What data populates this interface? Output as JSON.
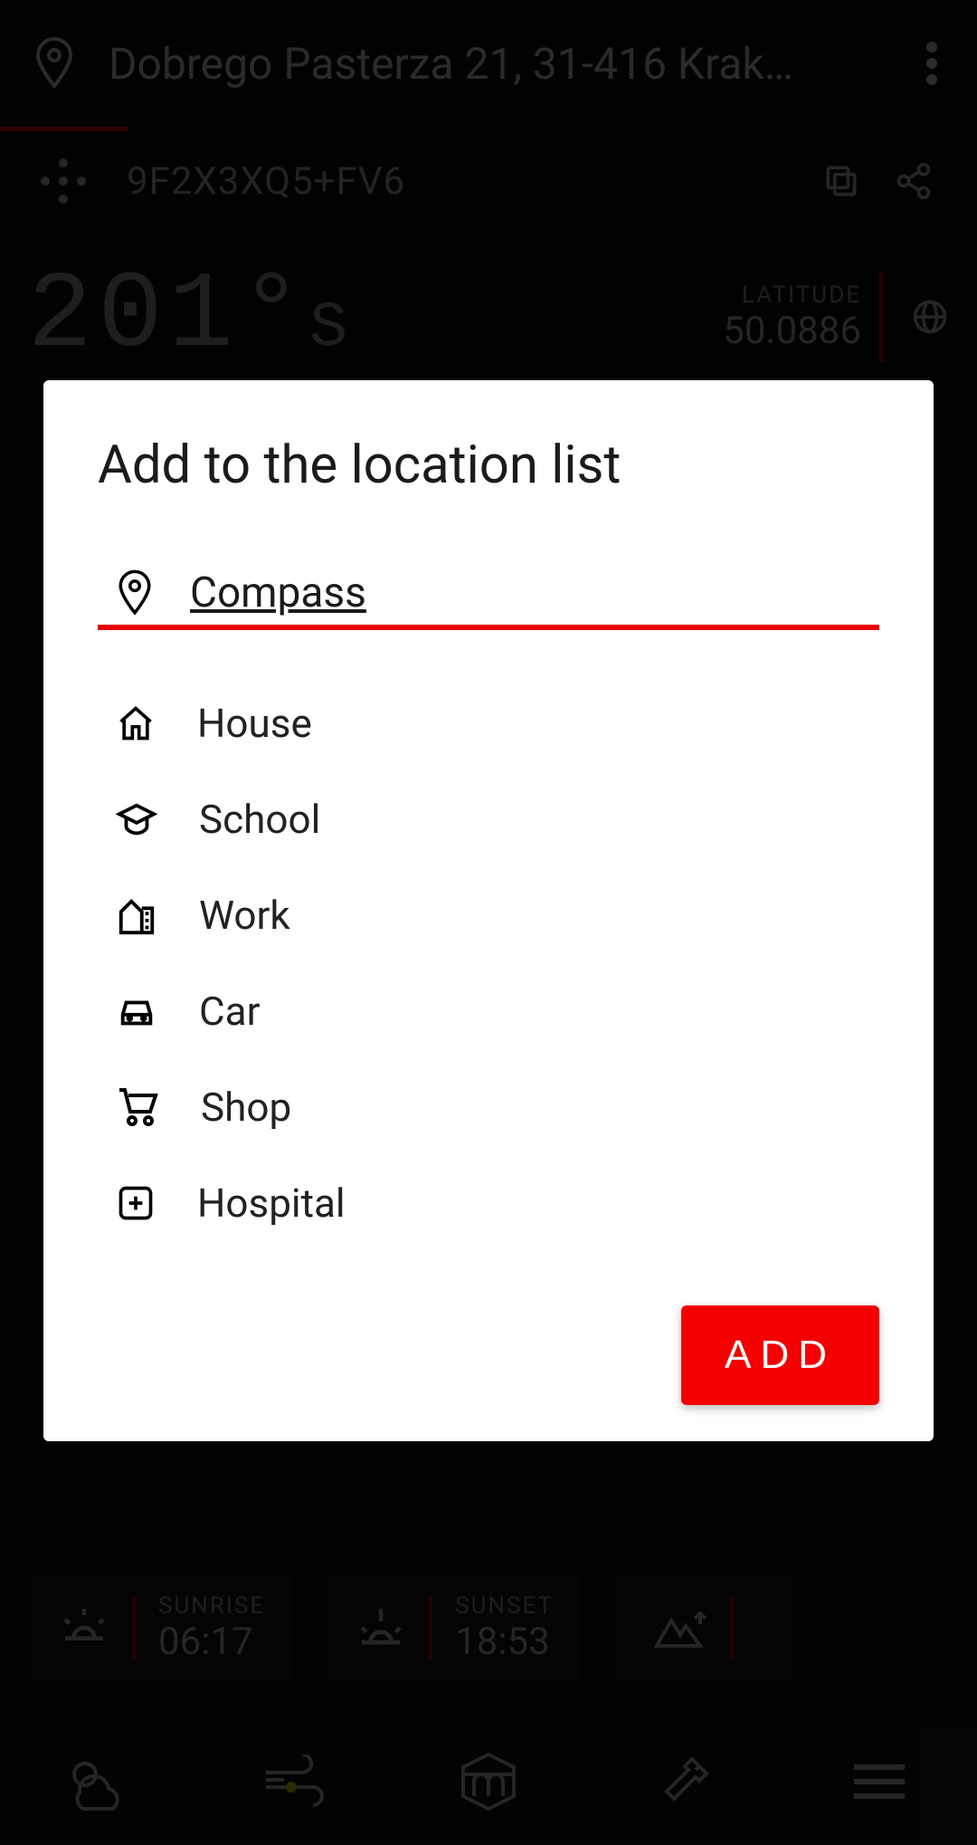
{
  "header": {
    "address": "Dobrego Pasterza 21, 31-416 Krak…",
    "plus_code": "9F2X3XQ5+FV6"
  },
  "compass": {
    "heading_value": "201",
    "heading_direction": "S",
    "latitude_label": "LATITUDE",
    "latitude_value": "50.0886"
  },
  "sun": {
    "sunrise_label": "SUNRISE",
    "sunrise_value": "06:17",
    "sunset_label": "SUNSET",
    "sunset_value": "18:53"
  },
  "dialog": {
    "title": "Add to the location list",
    "input_value": "Compass",
    "options": [
      {
        "icon": "home",
        "label": "House"
      },
      {
        "icon": "school",
        "label": "School"
      },
      {
        "icon": "work",
        "label": "Work"
      },
      {
        "icon": "car",
        "label": "Car"
      },
      {
        "icon": "shop",
        "label": "Shop"
      },
      {
        "icon": "hospital",
        "label": "Hospital"
      }
    ],
    "add_button": "ADD"
  },
  "colors": {
    "accent": "#e60000",
    "bg": "#0b0b0b"
  }
}
